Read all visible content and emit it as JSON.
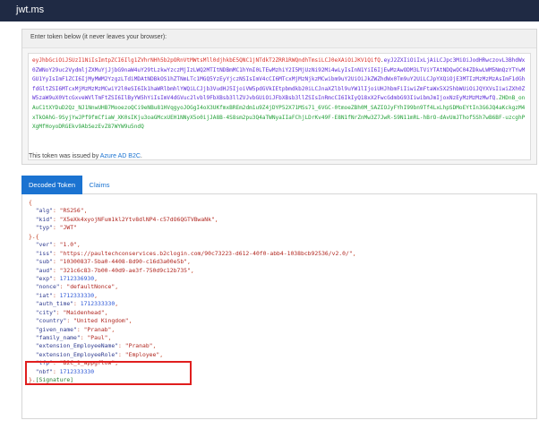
{
  "app": {
    "title": "jwt.ms"
  },
  "token_panel": {
    "header": "Enter token below (it never leaves your browser):",
    "encoded_header": "eyJhbGciOiJSUzI1NiIsImtpZCI6Ilg1ZVhrNHh5b2pORnVtMWtsMll0djhkbE5QNC1jNTdkT2ZRR1RWQndhTmsiLCJ0eXAiOiJKV1QifQ",
    "encoded_payload": "eyJ2ZXIiOiIxLjAiLCJpc3MiOiJodHRwczovL3BhdWx0ZWNoY29uc2VydmljZXMuYjJjbG9naW4uY29tLzkwYzczMjIzLWQ2MTItNDBmMC1hYmI0LTEwMzhiY2I5MjUzNi92Mi4wLyIsInN1YiI6IjEwMzAwODM3LTViYTAtNDQwOC04ZDkwLWM5NmQzYTYwMGU1YyIsImF1ZCI6IjMyMWM2YzgzLTdiMDAtNDBkOS1hZTNmLTc1MGQ5YzEyYjczNSIsImV4cCI6MTcxMjMzNjkzMCwibm9uY2UiOiJkZWZhdWx0Tm9uY2UiLCJpYXQiOjE3MTIzMzMzMzAsImF1dGhfdGltZSI6MTcxMjMzMzMzMCwiY2l0eSI6Ik1haWRlbmhlYWQiLCJjb3VudHJ5IjoiVW5pdGVkIEtpbmdkb20iLCJnaXZlbl9uYW1lIjoiUHJhbmFiIiwiZmFtaWx5X25hbWUiOiJQYXVsIiwiZXh0ZW5zaW9uX0VtcGxveWVlTmFtZSI6IlByYW5hYiIsImV4dGVuc2lvbl9FbXBsb3llZVJvbGUiOiJFbXBsb3llZSIsInRmcCI6IkIyQ18xX2FwcGdmbG93IiwibmJmIjoxNzEyMzMzMzMwfQ",
    "encoded_signature": "ZHDnB_onAuC1tXYDuD2Qz_NJ1NnwUHB7MooezoQCi9eNBu81HVqgyoJOGgI4oX3UKfmxBREm2dm1u9Z4jDYP52X71MSs71_6VGC-0tmoeZBh0M_SAZIOJyFYhI99bn9Tf4LxLhpSDMoEYtIn3G6JQ4aKckgzM4xTkOAhG-9SyjYwJPf9fmCfiaW_XK0sIKju3oaGMcxUEH1NNyX5o0ijJA8B-4S8sm2pu3Q4aTWNyaIIaFChjLDrKv49F-E8N1fNrZnMw3Z7JwR-S9N11mRL-hBrO-dAvUmJThof5Sh7wB6BF-uzcghPXgMfHoyoDRGEkv9AbSezEvZ87WYW9u5ndQ"
  },
  "issuer": {
    "text": "This token was issued by",
    "link": "Azure AD B2C",
    "suffix": "."
  },
  "tabs": [
    {
      "label": "Decoded Token"
    },
    {
      "label": "Claims"
    }
  ],
  "header_claims": [
    {
      "key": "alg",
      "value": "RS256"
    },
    {
      "key": "kid",
      "value": "X5eXk4xyojNFum1kl2Ytv8dlNP4-c57dO6QGTVBwaNk"
    },
    {
      "key": "typ",
      "value": "JWT"
    }
  ],
  "payload_claims": [
    {
      "key": "ver",
      "value": "1.0"
    },
    {
      "key": "iss",
      "value": "https://paultechconservices.b2clogin.com/90c73223-d612-40f0-abb4-1038bcb92536/v2.0/"
    },
    {
      "key": "sub",
      "value": "10300837-5ba0-4408-8d90-c16d3a00e5b"
    },
    {
      "key": "aud",
      "value": "321c6c83-7b00-40d9-ae3f-750d9c12b735"
    },
    {
      "key": "exp",
      "value": "1712336930"
    },
    {
      "key": "nonce",
      "value": "defaultNonce"
    },
    {
      "key": "iat",
      "value": "1712333330"
    },
    {
      "key": "auth_time",
      "value": "1712333330"
    },
    {
      "key": "city",
      "value": "Maidenhead"
    },
    {
      "key": "country",
      "value": "United Kingdom"
    },
    {
      "key": "given_name",
      "value": "Pranab"
    },
    {
      "key": "family_name",
      "value": "Paul"
    },
    {
      "key": "extension_EmployeeName",
      "value": "Pranab"
    },
    {
      "key": "extension_EmployeeRole",
      "value": "Employee"
    },
    {
      "key": "tfp",
      "value": "B2C_1_appgflow"
    },
    {
      "key": "nbf",
      "value": "1712333330"
    }
  ],
  "signature_label": "[Signature]",
  "colors": {
    "topbar": "#1f2a44",
    "accent": "#1b73d1",
    "header_segment": "#d9322d",
    "payload_segment": "#5b2bd6",
    "signature_segment": "#24a13a",
    "highlight_border": "#e01e1e"
  }
}
